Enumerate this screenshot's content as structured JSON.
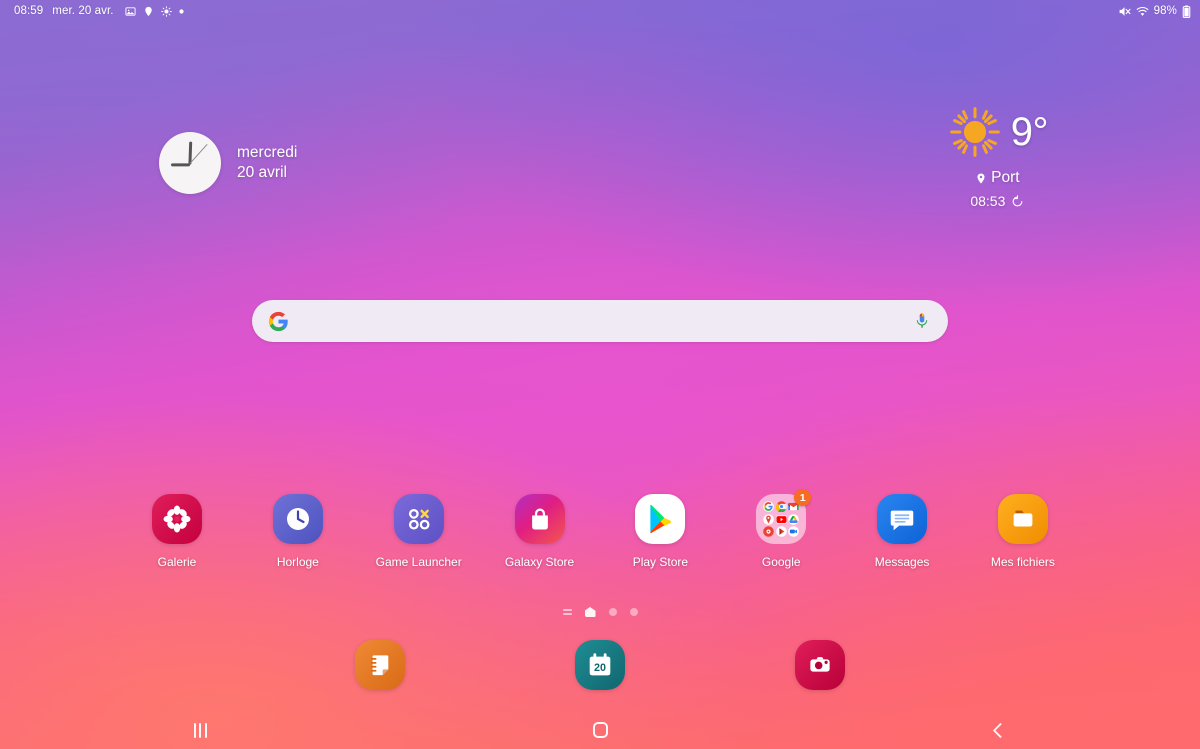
{
  "status_bar": {
    "time": "08:59",
    "date": "mer. 20 avr.",
    "icons": [
      "image-icon",
      "location-icon",
      "brightness-icon",
      "dot-icon"
    ],
    "right_icons": [
      "mute-icon",
      "wifi-icon"
    ],
    "battery_percent": "98%"
  },
  "clock_widget": {
    "weekday": "mercredi",
    "date": "20 avril",
    "type": "analog-clock"
  },
  "weather_widget": {
    "condition_icon": "sun-icon",
    "temperature": "9°",
    "location": "Port",
    "updated_time": "08:53",
    "refresh_icon": "refresh-icon"
  },
  "search_bar": {
    "leading_icon": "google-g-icon",
    "placeholder": "",
    "value": "",
    "trailing_icon": "microphone-icon"
  },
  "apps": [
    {
      "label": "Galerie",
      "icon": "gallery-icon",
      "color": "#d91d55"
    },
    {
      "label": "Horloge",
      "icon": "clock-icon",
      "color": "#5c63c8"
    },
    {
      "label": "Game Launcher",
      "icon": "game-launcher-icon",
      "color": "#6c5ed0"
    },
    {
      "label": "Galaxy Store",
      "icon": "galaxy-store-icon",
      "color": "#e4267f"
    },
    {
      "label": "Play Store",
      "icon": "play-store-icon",
      "color": "#ffffff"
    },
    {
      "label": "Google",
      "icon": "google-folder-icon",
      "color": "#f0d8ea",
      "badge": "1",
      "folder_apps": [
        "google-icon",
        "chrome-icon",
        "gmail-icon",
        "maps-icon",
        "youtube-icon",
        "drive-icon",
        "photos-icon",
        "play-movies-icon",
        "duo-icon"
      ]
    },
    {
      "label": "Messages",
      "icon": "messages-icon",
      "color": "#1a73e8"
    },
    {
      "label": "Mes fichiers",
      "icon": "my-files-icon",
      "color": "#f5a623"
    }
  ],
  "page_indicator": {
    "items": [
      "apps-list-icon",
      "home-page-active",
      "page-dot",
      "page-dot"
    ],
    "active_index": 1
  },
  "dock": [
    {
      "label": "Samsung Notes",
      "icon": "notes-icon",
      "color": "#e77a2b"
    },
    {
      "label": "Calendrier",
      "icon": "calendar-icon",
      "color": "#187d86",
      "day": "20"
    },
    {
      "label": "Appareil photo",
      "icon": "camera-icon",
      "color": "#d01348"
    }
  ],
  "nav_bar": {
    "recents_label": "Applications récentes",
    "home_label": "Accueil",
    "back_label": "Retour"
  },
  "colors": {
    "gradient_top": "#8a6bd1",
    "gradient_mid": "#e254cf",
    "gradient_bottom": "#fb6a6e",
    "accent_white": "#ffffff",
    "badge_orange": "#f76b25"
  }
}
